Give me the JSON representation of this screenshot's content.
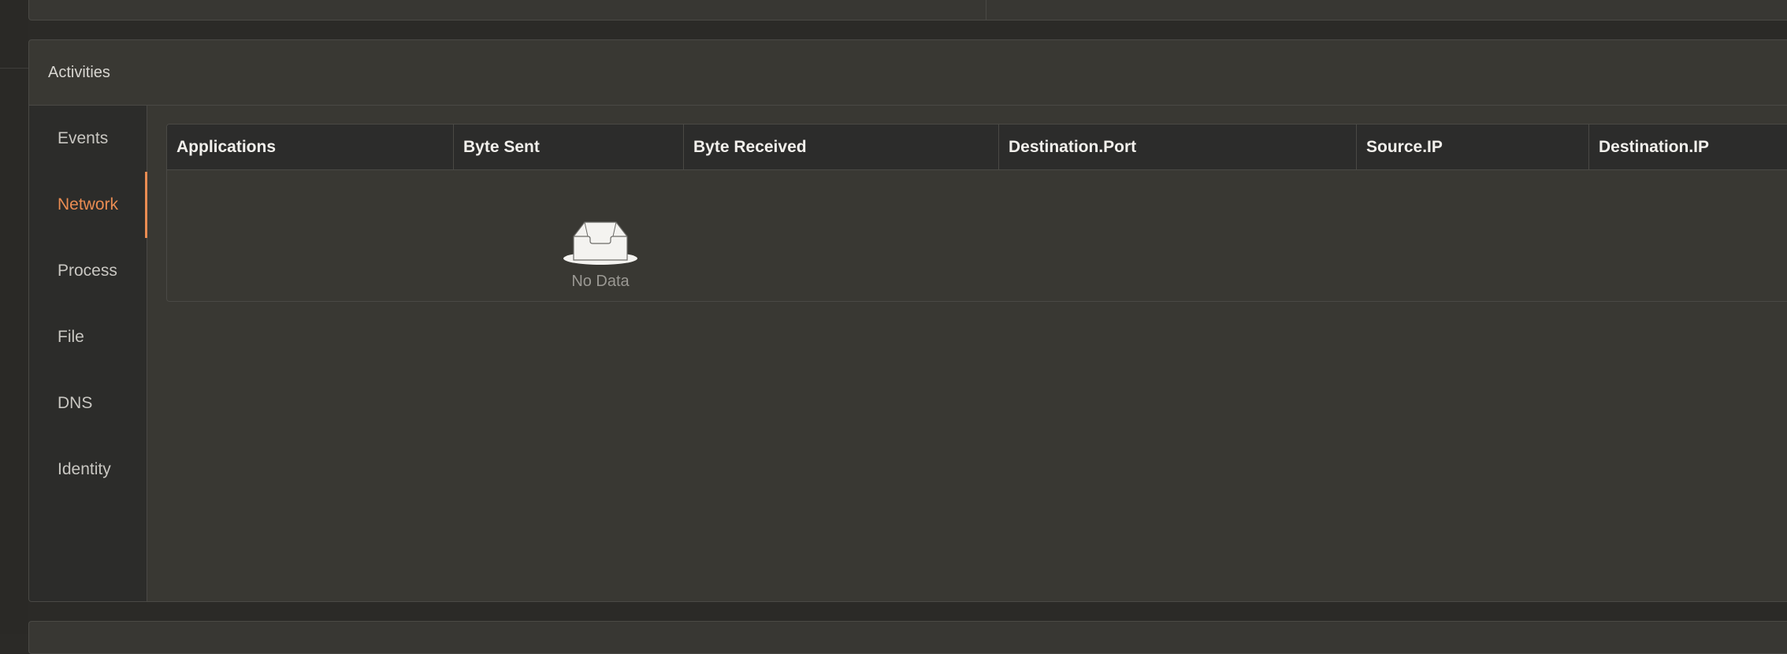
{
  "panel": {
    "title": "Activities"
  },
  "sidebar": {
    "tabs": [
      {
        "label": "Events",
        "active": false
      },
      {
        "label": "Network",
        "active": true
      },
      {
        "label": "Process",
        "active": false
      },
      {
        "label": "File",
        "active": false
      },
      {
        "label": "DNS",
        "active": false
      },
      {
        "label": "Identity",
        "active": false
      }
    ]
  },
  "table": {
    "columns": [
      "Applications",
      "Byte Sent",
      "Byte Received",
      "Destination.Port",
      "Source.IP",
      "Destination.IP"
    ],
    "rows": [],
    "empty_text": "No Data"
  },
  "colors": {
    "accent": "#ea8c52",
    "background": "#393833",
    "sidebar": "#2c2c2a"
  },
  "icons": {
    "empty": "inbox-icon"
  }
}
